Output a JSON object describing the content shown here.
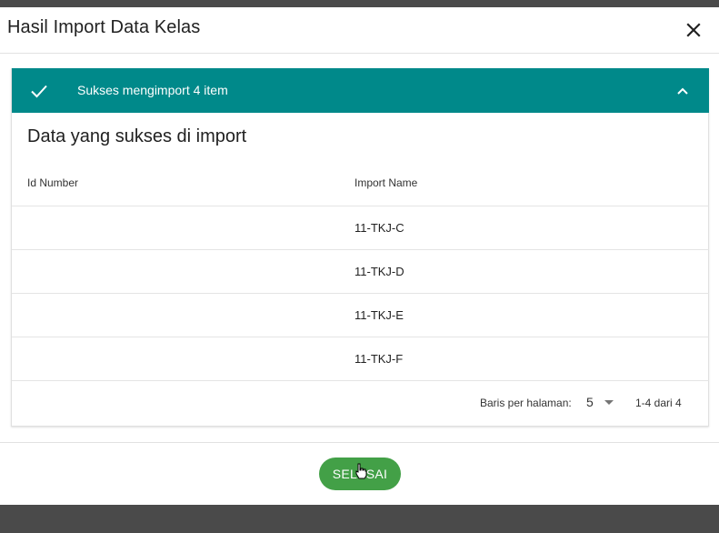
{
  "dialog": {
    "title": "Hasil Import Data Kelas",
    "close_icon": "close-icon"
  },
  "panel": {
    "header_text": "Sukses mengimport 4 item",
    "header_color": "#00898a",
    "check_icon": "check-icon",
    "toggle_icon": "chevron-up-icon",
    "section_title": "Data yang sukses di import",
    "columns": [
      "Id Number",
      "Import Name"
    ],
    "rows": [
      {
        "id_number": "",
        "import_name": "11-TKJ-C"
      },
      {
        "id_number": "",
        "import_name": "11-TKJ-D"
      },
      {
        "id_number": "",
        "import_name": "11-TKJ-E"
      },
      {
        "id_number": "",
        "import_name": "11-TKJ-F"
      }
    ]
  },
  "pagination": {
    "rows_label": "Baris per halaman:",
    "rows_value": "5",
    "range": "1-4 dari 4"
  },
  "footer": {
    "done_label": "SELESAI",
    "done_color": "#43a047"
  }
}
